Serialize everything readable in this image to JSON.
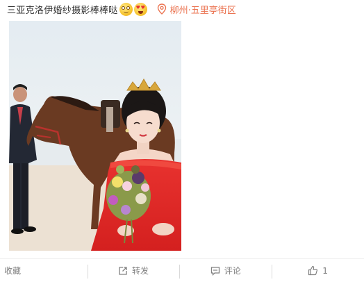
{
  "post": {
    "text": "三亚克洛伊婚纱摄影棒棒哒",
    "emojis": [
      "blush-face",
      "heart-eyes-face"
    ],
    "location": "柳州·五里亭街区"
  },
  "photo": {
    "description_icon": "wedding-photo"
  },
  "actions": {
    "collect": "收藏",
    "repost": "转发",
    "comment": "评论",
    "like_count": "1"
  },
  "colors": {
    "location": "#eb7350",
    "action_text": "#808080",
    "dress": "#e0302c"
  }
}
